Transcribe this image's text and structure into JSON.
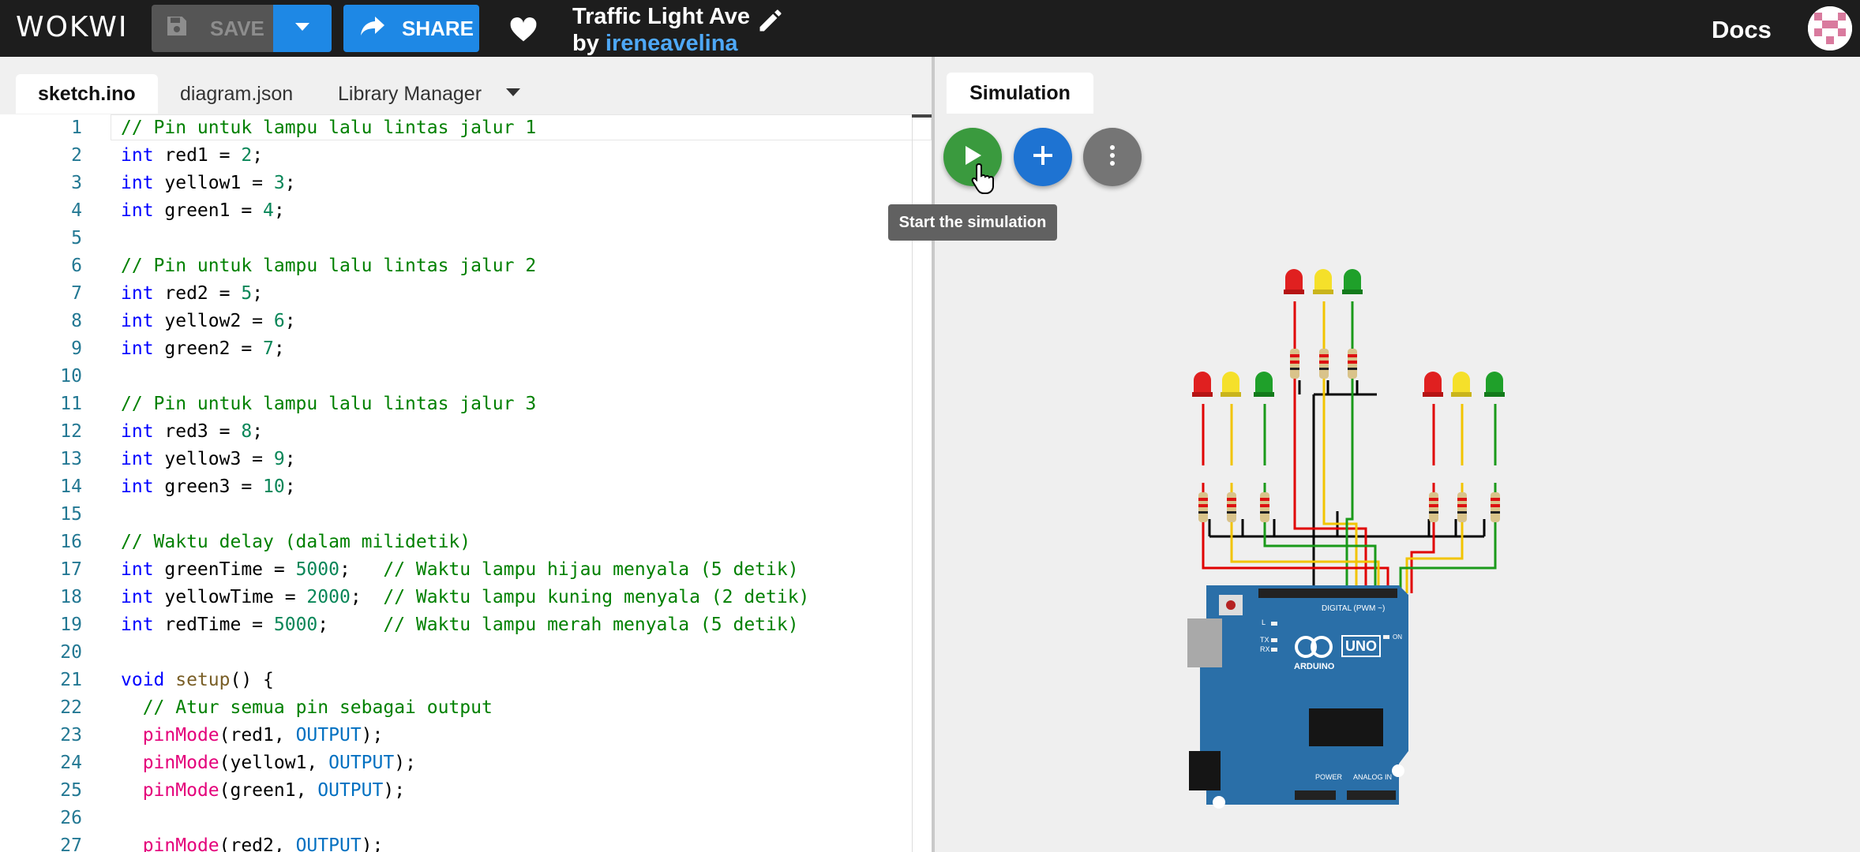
{
  "header": {
    "logo": "WOKWI",
    "save_label": "SAVE",
    "share_label": "SHARE",
    "project_title": "Traffic Light Ave",
    "by_label": "by ",
    "author": "ireneavelina",
    "docs_label": "Docs"
  },
  "editor": {
    "tabs": [
      {
        "label": "sketch.ino",
        "active": true
      },
      {
        "label": "diagram.json",
        "active": false
      },
      {
        "label": "Library Manager",
        "active": false
      }
    ],
    "line_numbers": [
      "1",
      "2",
      "3",
      "4",
      "5",
      "6",
      "7",
      "8",
      "9",
      "10",
      "11",
      "12",
      "13",
      "14",
      "15",
      "16",
      "17",
      "18",
      "19",
      "20",
      "21",
      "22",
      "23",
      "24",
      "25",
      "26",
      "27"
    ],
    "code": [
      "// Pin untuk lampu lalu lintas jalur 1",
      "int red1 = 2;",
      "int yellow1 = 3;",
      "int green1 = 4;",
      "",
      "// Pin untuk lampu lalu lintas jalur 2",
      "int red2 = 5;",
      "int yellow2 = 6;",
      "int green2 = 7;",
      "",
      "// Pin untuk lampu lalu lintas jalur 3",
      "int red3 = 8;",
      "int yellow3 = 9;",
      "int green3 = 10;",
      "",
      "// Waktu delay (dalam milidetik)",
      "int greenTime = 5000;   // Waktu lampu hijau menyala (5 detik)",
      "int yellowTime = 2000;  // Waktu lampu kuning menyala (2 detik)",
      "int redTime = 5000;     // Waktu lampu merah menyala (5 detik)",
      "",
      "void setup() {",
      "  // Atur semua pin sebagai output",
      "  pinMode(red1, OUTPUT);",
      "  pinMode(yellow1, OUTPUT);",
      "  pinMode(green1, OUTPUT);",
      "",
      "  pinMode(red2, OUTPUT);"
    ]
  },
  "simulation": {
    "tab_label": "Simulation",
    "tooltip": "Start the simulation",
    "board": {
      "name": "UNO",
      "brand": "ARDUINO",
      "digital_label": "DIGITAL (PWM ~)",
      "power_label": "POWER",
      "analog_label": "ANALOG IN",
      "tx_label": "TX",
      "rx_label": "RX",
      "l_label": "L",
      "on_label": "ON"
    },
    "leds": [
      "red",
      "yellow",
      "green",
      "red",
      "yellow",
      "green",
      "red",
      "yellow",
      "green"
    ]
  },
  "colors": {
    "header_bg": "#1d1d1d",
    "accent_blue": "#1e88e5",
    "start_green": "#3a9a3e",
    "board_blue": "#2a6fa8"
  }
}
